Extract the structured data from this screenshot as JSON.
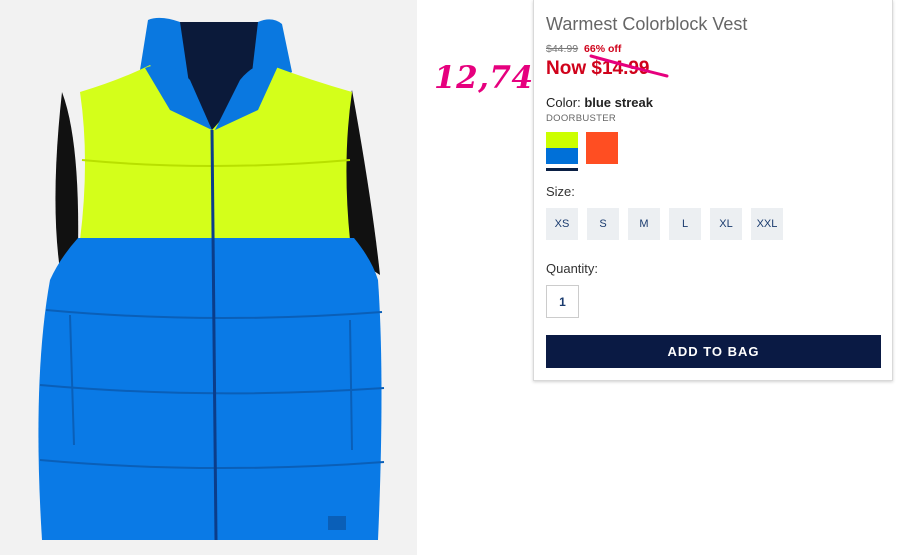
{
  "product": {
    "title": "Warmest Colorblock Vest",
    "original_price": "$44.99",
    "discount": "66% off",
    "now_price": "Now $14.99",
    "color_label": "Color:",
    "color_name": "blue streak",
    "promo_tag": "DOORBUSTER",
    "swatches": [
      {
        "name": "blue streak",
        "colors": [
          "#ccff00",
          "#0070d8"
        ]
      },
      {
        "name": "orange",
        "colors": [
          "#ff4e22"
        ]
      }
    ],
    "size_label": "Size:",
    "sizes": [
      "XS",
      "S",
      "M",
      "L",
      "XL",
      "XXL"
    ],
    "quantity_label": "Quantity:",
    "quantity_value": "1",
    "add_to_bag_label": "ADD TO BAG"
  },
  "annotation": {
    "handwritten_price": "12,74",
    "color": "#e6007e"
  },
  "colors": {
    "accent_red": "#d0021b",
    "button_navy": "#0a1a44",
    "size_text": "#1a3b6e"
  }
}
